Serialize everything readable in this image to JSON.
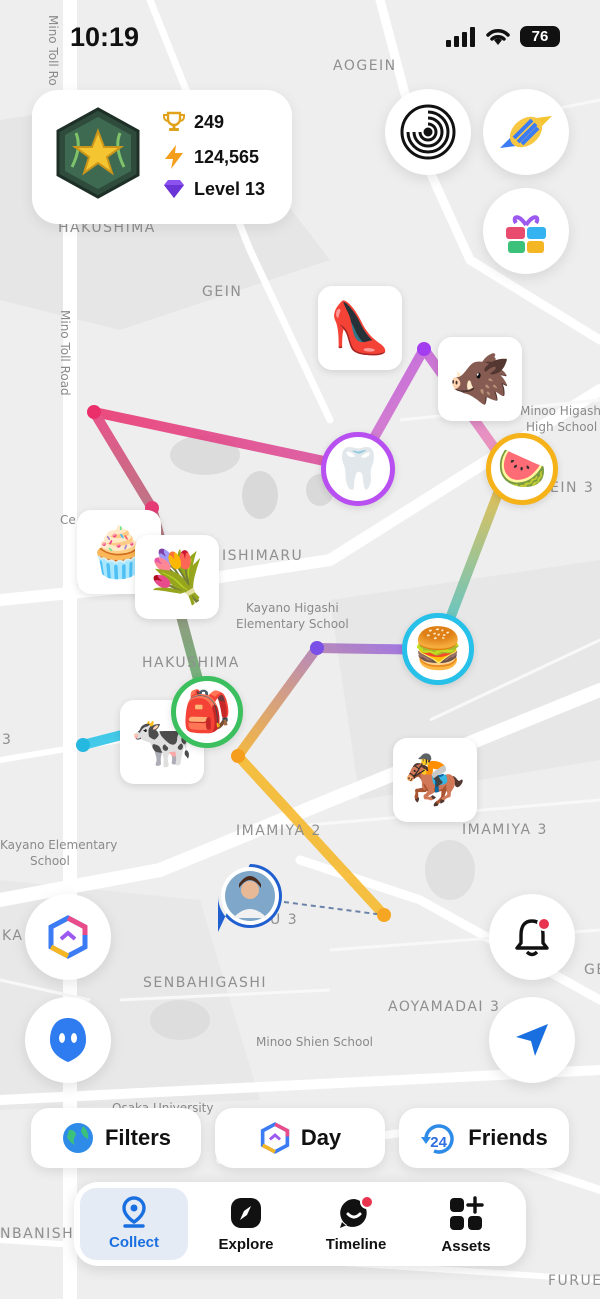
{
  "status_bar": {
    "time": "10:19",
    "battery": "76"
  },
  "map": {
    "labels": {
      "aogein": "AOGEIN",
      "hakushima_top": "HAKUSHIMA",
      "gein": "GEIN",
      "mino_toll_road_top": "Mino Toll Ro",
      "mino_toll_road": "Mino Toll Road",
      "minoo_higashi": "Minoo Higashi",
      "high_school": "High School",
      "ein3": "EIN 3",
      "ishimaru": "ISHIMARU",
      "ce": "Ce",
      "kayano_higashi": "Kayano Higashi",
      "elementary_school": "Elementary School",
      "hakushima_mid": "HAKUSHIMA",
      "three_left": "3",
      "kayano_elementary": "Kayano Elementary",
      "school": "School",
      "imamiya2": "IMAMIYA 2",
      "imamiya3": "IMAMIYA 3",
      "ka": "KA",
      "u3": "U 3",
      "senbahigashi": "SENBAHIGASHI",
      "aoyamadai3": "AOYAMADAI 3",
      "minoo_shien": "Minoo Shien School",
      "osaka_university": "Osaka University",
      "nbanishi": "NBANISHI",
      "furue": "FURUE",
      "ge": "GE"
    }
  },
  "profile": {
    "badge_icon": "star-emblem-icon",
    "trophies": "249",
    "energy": "124,565",
    "level": "Level 13"
  },
  "top_buttons": [
    "spiral-icon",
    "candy-icon",
    "gift-icon"
  ],
  "items": {
    "shoe": "👠",
    "creature": "🐗",
    "teeth": "🦷",
    "watermelon": "🍉",
    "cake": "🧁",
    "flowers": "💐",
    "burger": "🍔",
    "backpack": "🎒",
    "cow": "🐄",
    "horse": "🏇"
  },
  "side_buttons": [
    "hexagon-logo-icon",
    "ghost-icon",
    "bell-icon",
    "location-arrow-icon"
  ],
  "quick_actions": {
    "filters": "Filters",
    "day": "Day",
    "friends": "Friends",
    "friends_badge": "24"
  },
  "tabs": [
    {
      "label": "Collect",
      "icon": "map-pin-icon"
    },
    {
      "label": "Explore",
      "icon": "compass-icon"
    },
    {
      "label": "Timeline",
      "icon": "timeline-icon"
    },
    {
      "label": "Assets",
      "icon": "grid-plus-icon"
    }
  ],
  "colors": {
    "accent_blue": "#1a6fe0",
    "route_red": "#ea2f6a",
    "route_purple": "#a45ef5",
    "route_orange": "#f6a623",
    "route_cyan": "#25c3e6"
  }
}
